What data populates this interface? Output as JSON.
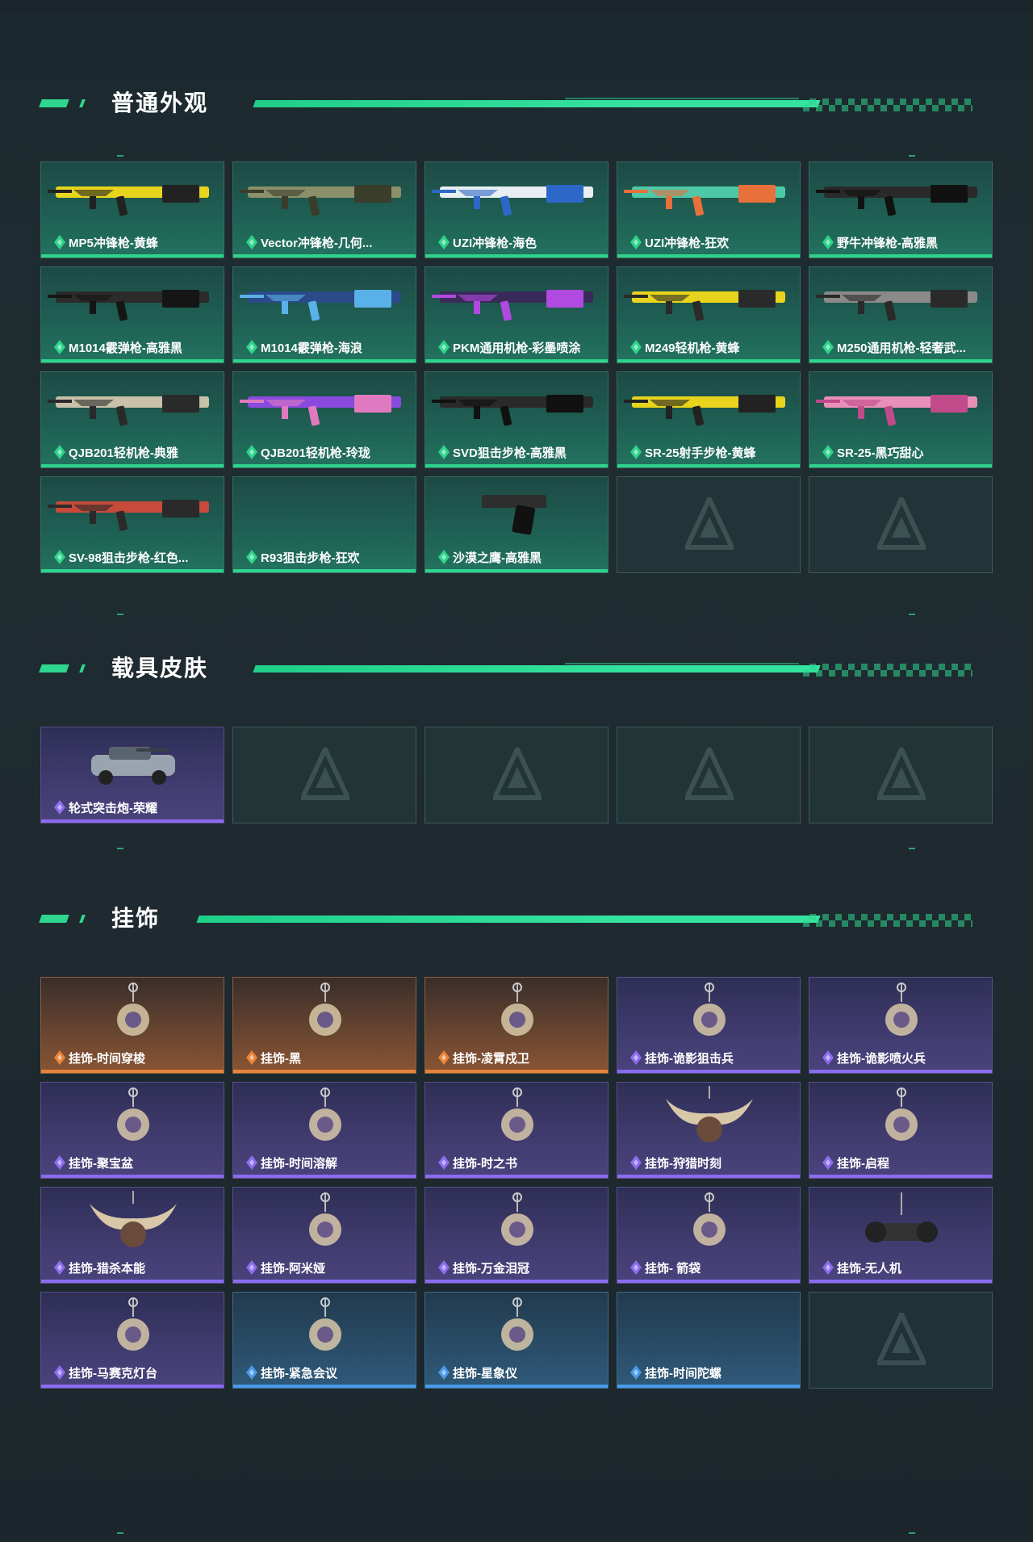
{
  "sections": [
    {
      "title": "普通外观",
      "items": [
        {
          "label": "MP5冲锋枪-黄蜂",
          "rarity": "green",
          "icon": "smg-yellow-icon"
        },
        {
          "label": "Vector冲锋枪-几何...",
          "rarity": "green",
          "icon": "smg-camo-icon"
        },
        {
          "label": "UZI冲锋枪-海色",
          "rarity": "green",
          "icon": "uzi-blue-icon"
        },
        {
          "label": "UZI冲锋枪-狂欢",
          "rarity": "green",
          "icon": "uzi-colorful-icon"
        },
        {
          "label": "野牛冲锋枪-高雅黑",
          "rarity": "green",
          "icon": "smg-black-icon"
        },
        {
          "label": "M1014霰弹枪-高雅黑",
          "rarity": "green",
          "icon": "shotgun-black-icon"
        },
        {
          "label": "M1014霰弹枪-海浪",
          "rarity": "green",
          "icon": "shotgun-wave-icon"
        },
        {
          "label": "PKM通用机枪-彩墨喷涂",
          "rarity": "green",
          "icon": "mg-paint-icon"
        },
        {
          "label": "M249轻机枪-黄蜂",
          "rarity": "green",
          "icon": "lmg-yellow-icon"
        },
        {
          "label": "M250通用机枪-轻奢武...",
          "rarity": "green",
          "icon": "mg-grey-icon"
        },
        {
          "label": "QJB201轻机枪-典雅",
          "rarity": "green",
          "icon": "lmg-classic-icon"
        },
        {
          "label": "QJB201轻机枪-玲珑",
          "rarity": "green",
          "icon": "lmg-purple-icon"
        },
        {
          "label": "SVD狙击步枪-高雅黑",
          "rarity": "green",
          "icon": "sniper-black-icon"
        },
        {
          "label": "SR-25射手步枪-黄蜂",
          "rarity": "green",
          "icon": "rifle-yellow-icon"
        },
        {
          "label": "SR-25-黑巧甜心",
          "rarity": "green",
          "icon": "rifle-pink-icon"
        },
        {
          "label": "SV-98狙击步枪-红色...",
          "rarity": "green",
          "icon": "sniper-red-icon"
        },
        {
          "label": "R93狙击步枪-狂欢",
          "rarity": "green",
          "icon": ""
        },
        {
          "label": "沙漠之鹰-高雅黑",
          "rarity": "green",
          "icon": "pistol-black-icon"
        },
        {
          "label": "",
          "rarity": "empty",
          "icon": "placeholder-logo-icon"
        },
        {
          "label": "",
          "rarity": "empty",
          "icon": "placeholder-logo-icon"
        }
      ]
    },
    {
      "title": "载具皮肤",
      "items": [
        {
          "label": "轮式突击炮-荣耀",
          "rarity": "purple",
          "icon": "vehicle-icon"
        },
        {
          "label": "",
          "rarity": "empty",
          "icon": "placeholder-logo-icon"
        },
        {
          "label": "",
          "rarity": "empty",
          "icon": "placeholder-logo-icon"
        },
        {
          "label": "",
          "rarity": "empty",
          "icon": "placeholder-logo-icon"
        },
        {
          "label": "",
          "rarity": "empty",
          "icon": "placeholder-logo-icon"
        }
      ]
    },
    {
      "title": "挂饰",
      "items": [
        {
          "label": "挂饰-时间穿梭",
          "rarity": "orange",
          "icon": "charm-icon"
        },
        {
          "label": "挂饰-黑",
          "rarity": "orange",
          "icon": "charm-icon"
        },
        {
          "label": "挂饰-凌霄戍卫",
          "rarity": "orange",
          "icon": "charm-icon"
        },
        {
          "label": "挂饰-诡影狙击兵",
          "rarity": "purple",
          "icon": "charm-icon"
        },
        {
          "label": "挂饰-诡影喷火兵",
          "rarity": "purple",
          "icon": "charm-icon"
        },
        {
          "label": "挂饰-聚宝盆",
          "rarity": "purple",
          "icon": "charm-icon"
        },
        {
          "label": "挂饰-时间溶解",
          "rarity": "purple",
          "icon": "charm-icon"
        },
        {
          "label": "挂饰-时之书",
          "rarity": "purple",
          "icon": "charm-icon"
        },
        {
          "label": "挂饰-狩猎时刻",
          "rarity": "purple",
          "icon": "antler-charm-icon"
        },
        {
          "label": "挂饰-启程",
          "rarity": "purple",
          "icon": "charm-icon"
        },
        {
          "label": "挂饰-猎杀本能",
          "rarity": "purple",
          "icon": "antler-charm-icon"
        },
        {
          "label": "挂饰-阿米娅",
          "rarity": "purple",
          "icon": "charm-icon"
        },
        {
          "label": "挂饰-万金泪冠",
          "rarity": "purple",
          "icon": "charm-icon"
        },
        {
          "label": "挂饰- 箭袋",
          "rarity": "purple",
          "icon": "charm-icon"
        },
        {
          "label": "挂饰-无人机",
          "rarity": "purple",
          "icon": "drone-charm-icon"
        },
        {
          "label": "挂饰-马赛克灯台",
          "rarity": "purple",
          "icon": "charm-icon"
        },
        {
          "label": "挂饰-紧急会议",
          "rarity": "blue",
          "icon": "charm-icon"
        },
        {
          "label": "挂饰-星象仪",
          "rarity": "blue",
          "icon": "charm-icon"
        },
        {
          "label": "挂饰-时间陀螺",
          "rarity": "blue",
          "icon": ""
        },
        {
          "label": "",
          "rarity": "empty",
          "icon": "placeholder-logo-icon"
        }
      ]
    }
  ],
  "colors": {
    "accent": "#2fd68f",
    "green": "#2dd48b",
    "purple": "#8b6cf0",
    "orange": "#e8843a",
    "blue": "#4a9ae8"
  }
}
